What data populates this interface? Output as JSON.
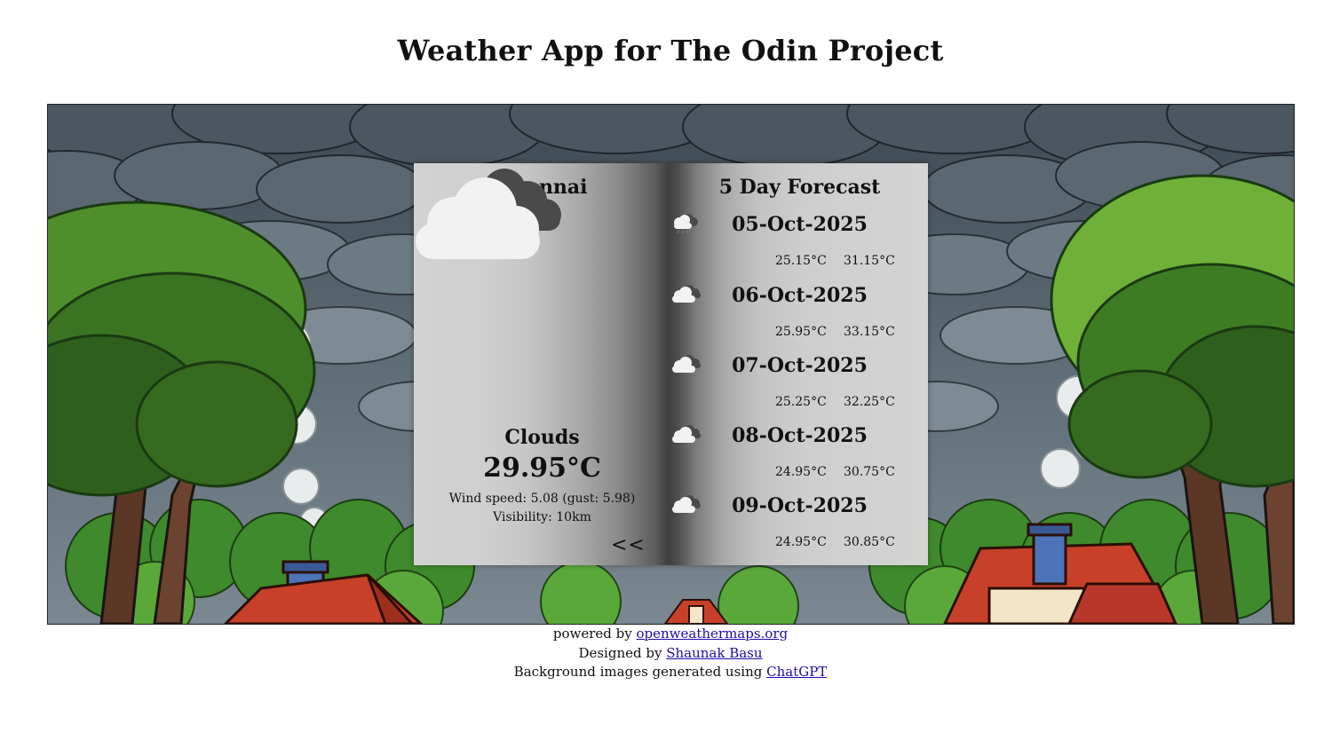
{
  "app": {
    "title": "Weather App for The Odin Project"
  },
  "current": {
    "city": "Chennai",
    "icon": "clouds-icon",
    "condition": "Clouds",
    "temperature": "29.95°C",
    "wind_prefix": "Wind speed: ",
    "wind_speed": "5.08",
    "gust_prefix": " (gust: ",
    "gust": "5.98",
    "gust_suffix": ")",
    "visibility_prefix": "Visibility: ",
    "visibility": "10km",
    "toggle_label": "<<"
  },
  "forecast": {
    "title": "5 Day Forecast",
    "days": [
      {
        "date": "05-Oct-2025",
        "icon": "rain-cloud-icon",
        "min": "25.15°C",
        "max": "31.15°C"
      },
      {
        "date": "06-Oct-2025",
        "icon": "clouds-icon",
        "min": "25.95°C",
        "max": "33.15°C"
      },
      {
        "date": "07-Oct-2025",
        "icon": "clouds-icon",
        "min": "25.25°C",
        "max": "32.25°C"
      },
      {
        "date": "08-Oct-2025",
        "icon": "clouds-icon",
        "min": "24.95°C",
        "max": "30.75°C"
      },
      {
        "date": "09-Oct-2025",
        "icon": "clouds-icon",
        "min": "24.95°C",
        "max": "30.85°C"
      }
    ]
  },
  "footer": {
    "powered_prefix": "powered by ",
    "powered_link": "openweathermaps.org",
    "designed_prefix": "Designed by ",
    "designer_link": "Shaunak Basu",
    "images_prefix": "Background images generated using ",
    "images_link": "ChatGPT"
  },
  "colors": {
    "link": "#1a0dab",
    "sky": "#4f5c66",
    "foliage": "#3f8a2c",
    "roof": "#c8402a"
  }
}
